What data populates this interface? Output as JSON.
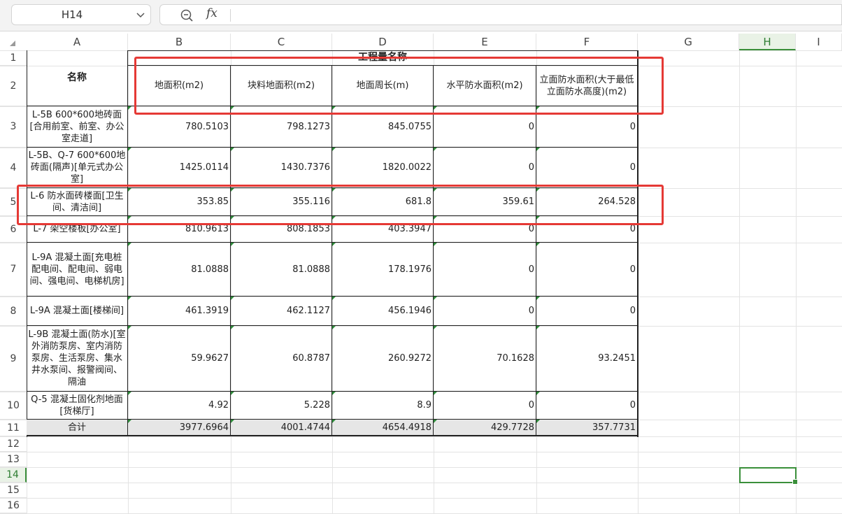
{
  "name_box": {
    "value": "H14"
  },
  "formula_bar": {
    "fx_label": "fx",
    "content": ""
  },
  "columns": [
    "A",
    "B",
    "C",
    "D",
    "E",
    "F",
    "G",
    "H",
    "I"
  ],
  "rows": [
    "1",
    "2",
    "3",
    "4",
    "5",
    "6",
    "7",
    "8",
    "9",
    "10",
    "11",
    "12",
    "13",
    "14",
    "15",
    "16"
  ],
  "active_cell": "H14",
  "table": {
    "name_header": "名称",
    "group_header": "工程量名称",
    "headers": [
      "地面积(m2)",
      "块料地面积(m2)",
      "地面周长(m)",
      "水平防水面积(m2)",
      "立面防水面积(大于最低立面防水高度)(m2)"
    ],
    "rows": [
      {
        "name": "L-5B 600*600地砖面[合用前室、前室、办公室走道]",
        "values": [
          "780.5103",
          "798.1273",
          "845.0755",
          "0",
          "0"
        ]
      },
      {
        "name": "L-5B、Q-7 600*600地砖面(隔声)[单元式办公室]",
        "values": [
          "1425.0114",
          "1430.7376",
          "1820.0022",
          "0",
          "0"
        ]
      },
      {
        "name": "L-6 防水面砖楼面[卫生间、清洁间]",
        "values": [
          "353.85",
          "355.116",
          "681.8",
          "359.61",
          "264.528"
        ]
      },
      {
        "name": "L-7 架空楼板[办公室]",
        "values": [
          "810.9613",
          "808.1853",
          "403.3947",
          "0",
          "0"
        ]
      },
      {
        "name": "L-9A 混凝土面[充电桩配电间、配电间、弱电间、强电间、电梯机房]",
        "values": [
          "81.0888",
          "81.0888",
          "178.1976",
          "0",
          "0"
        ]
      },
      {
        "name": "L-9A 混凝土面[楼梯间]",
        "values": [
          "461.3919",
          "462.1127",
          "456.1946",
          "0",
          "0"
        ]
      },
      {
        "name": "L-9B 混凝土面(防水)[室外消防泵房、室内消防泵房、生活泵房、集水井水泵间、报警阀间、隔油",
        "values": [
          "59.9627",
          "60.8787",
          "260.9272",
          "70.1628",
          "93.2451"
        ]
      },
      {
        "name": "Q-5 混凝土固化剂地面[货梯厅]",
        "values": [
          "4.92",
          "5.228",
          "8.9",
          "0",
          "0"
        ]
      }
    ],
    "total": {
      "name": "合计",
      "values": [
        "3977.6964",
        "4001.4744",
        "4654.4918",
        "429.7728",
        "357.7731"
      ]
    }
  },
  "colors": {
    "highlight_box": "#e53935",
    "selection": "#3a8f3a",
    "total_row_bg": "#e6e6e6"
  }
}
